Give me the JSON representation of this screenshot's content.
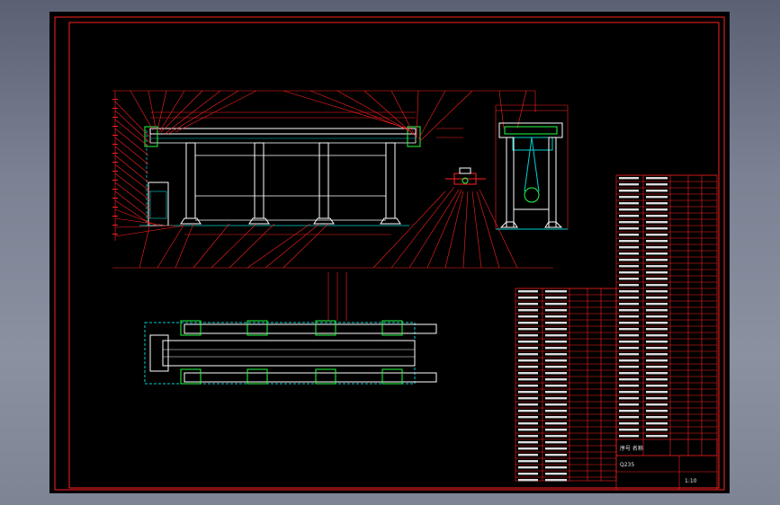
{
  "viewport": {
    "background": "#000000",
    "frame_color": "#ff2020",
    "line_color": "#ff2020",
    "structure_color": "#ffffff",
    "aux_color": "#00d0d0",
    "part_color": "#20ff40"
  },
  "title_block": {
    "table_title": "序号 名称",
    "material": "Q235",
    "scale": "1:10"
  }
}
